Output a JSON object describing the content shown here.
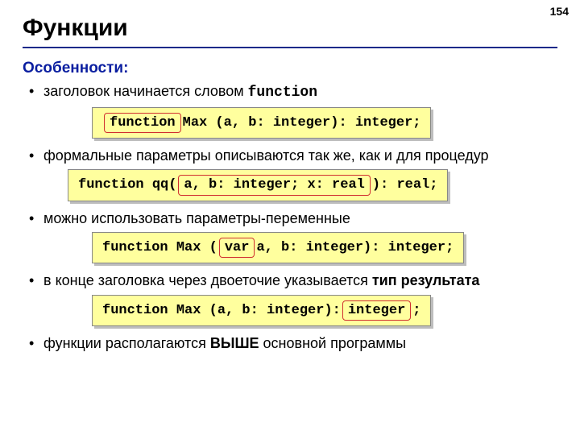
{
  "page_number": "154",
  "title": "Функции",
  "subhead": "Особенности:",
  "bullets": {
    "b1_pre": "заголовок начинается словом ",
    "b1_kw": "function",
    "b2": "формальные параметры описываются так же, как и для процедур",
    "b3": "можно использовать параметры-переменные",
    "b4_pre": "в конце заголовка через двоеточие указывается ",
    "b4_bold": "тип результата",
    "b5_pre": "функции располагаются ",
    "b5_bold": "ВЫШЕ",
    "b5_post": " основной программы"
  },
  "code": {
    "c1_hl": "function",
    "c1_rest": " Max (a, b: integer): integer;",
    "c2_pre": "function qq(",
    "c2_hl": " a, b: integer; x: real ",
    "c2_post": "): real;",
    "c3_pre": "function Max (",
    "c3_hl": " var ",
    "c3_post": "a, b: integer): integer;",
    "c4_pre": "function Max (a, b: integer):",
    "c4_hl": " integer ",
    "c4_post": ";"
  }
}
